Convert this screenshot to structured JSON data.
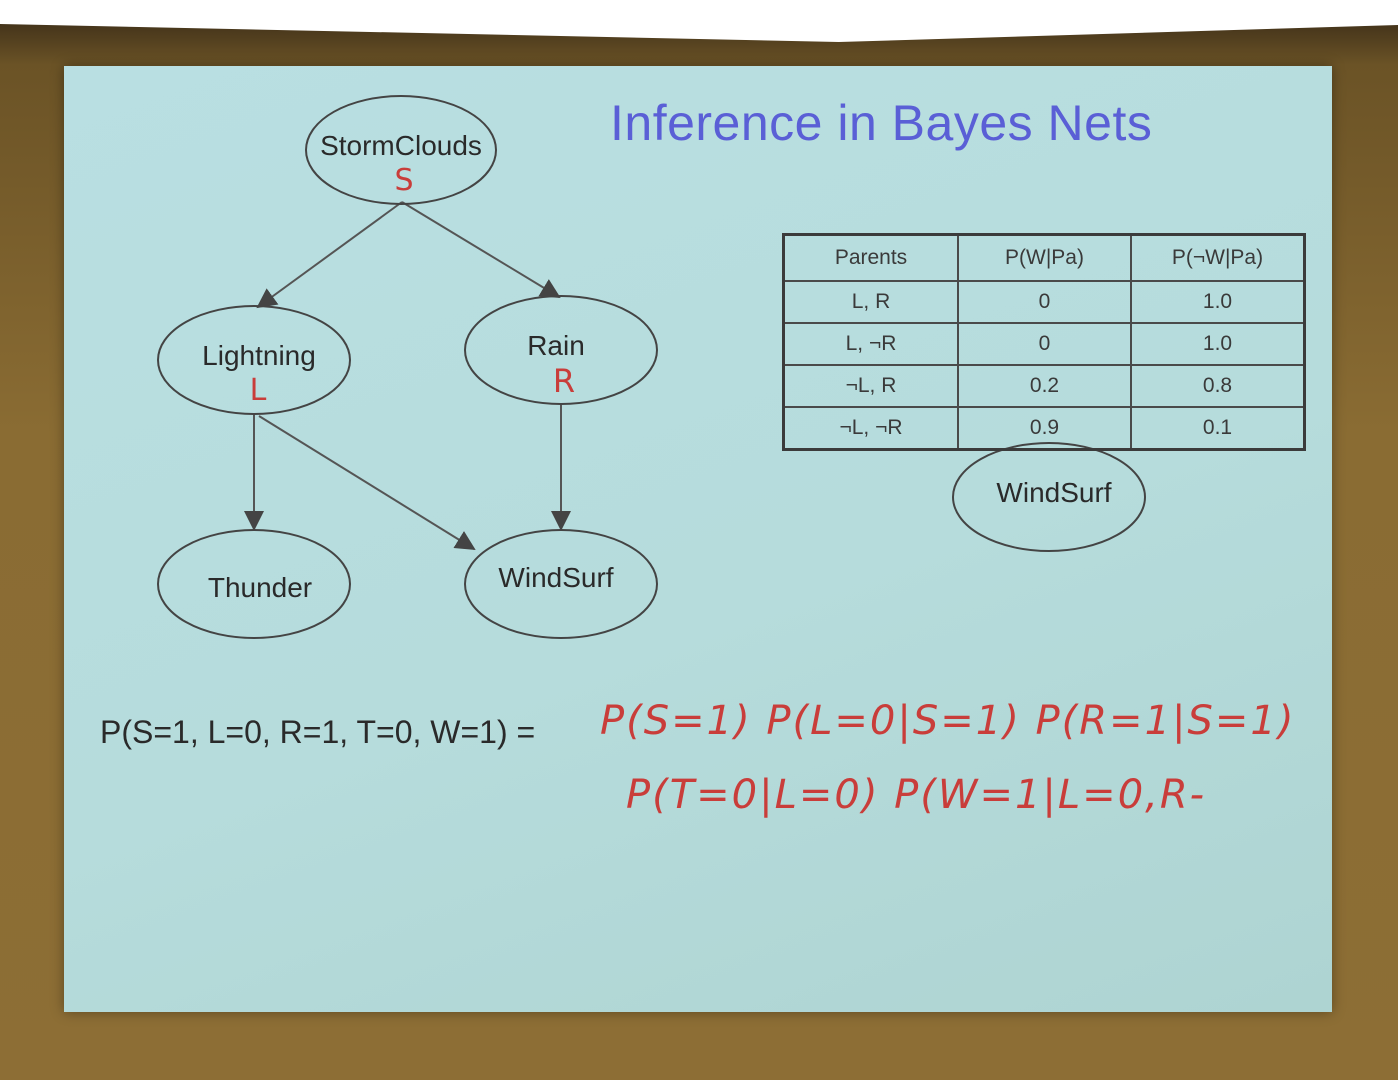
{
  "title": "Inference in Bayes Nets",
  "nodes": {
    "storm_clouds": {
      "label": "StormClouds",
      "annotation": "S"
    },
    "lightning": {
      "label": "Lightning",
      "annotation": "L"
    },
    "rain": {
      "label": "Rain",
      "annotation": "R"
    },
    "thunder": {
      "label": "Thunder"
    },
    "windsurf": {
      "label": "WindSurf"
    },
    "windsurf_cpt": {
      "label": "WindSurf"
    }
  },
  "edges": [
    {
      "from": "StormClouds",
      "to": "Lightning"
    },
    {
      "from": "StormClouds",
      "to": "Rain"
    },
    {
      "from": "Lightning",
      "to": "Thunder"
    },
    {
      "from": "Lightning",
      "to": "WindSurf"
    },
    {
      "from": "Rain",
      "to": "WindSurf"
    }
  ],
  "cpt": {
    "headers": [
      "Parents",
      "P(W|Pa)",
      "P(¬W|Pa)"
    ],
    "rows": [
      [
        "L, R",
        "0",
        "1.0"
      ],
      [
        "L, ¬R",
        "0",
        "1.0"
      ],
      [
        "¬L, R",
        "0.2",
        "0.8"
      ],
      [
        "¬L, ¬R",
        "0.9",
        "0.1"
      ]
    ]
  },
  "equation": {
    "lhs": "P(S=1, L=0, R=1, T=0, W=1)  =",
    "handwritten_line1": "P(S=1) P(L=0|S=1) P(R=1|S=1)",
    "handwritten_line2": "P(T=0|L=0) P(W=1|L=0,R-"
  },
  "colors": {
    "slide_bg": "#b6dcdc",
    "title": "#5a5fd6",
    "ink": "#c93d3a",
    "text": "#2a2a2a"
  }
}
